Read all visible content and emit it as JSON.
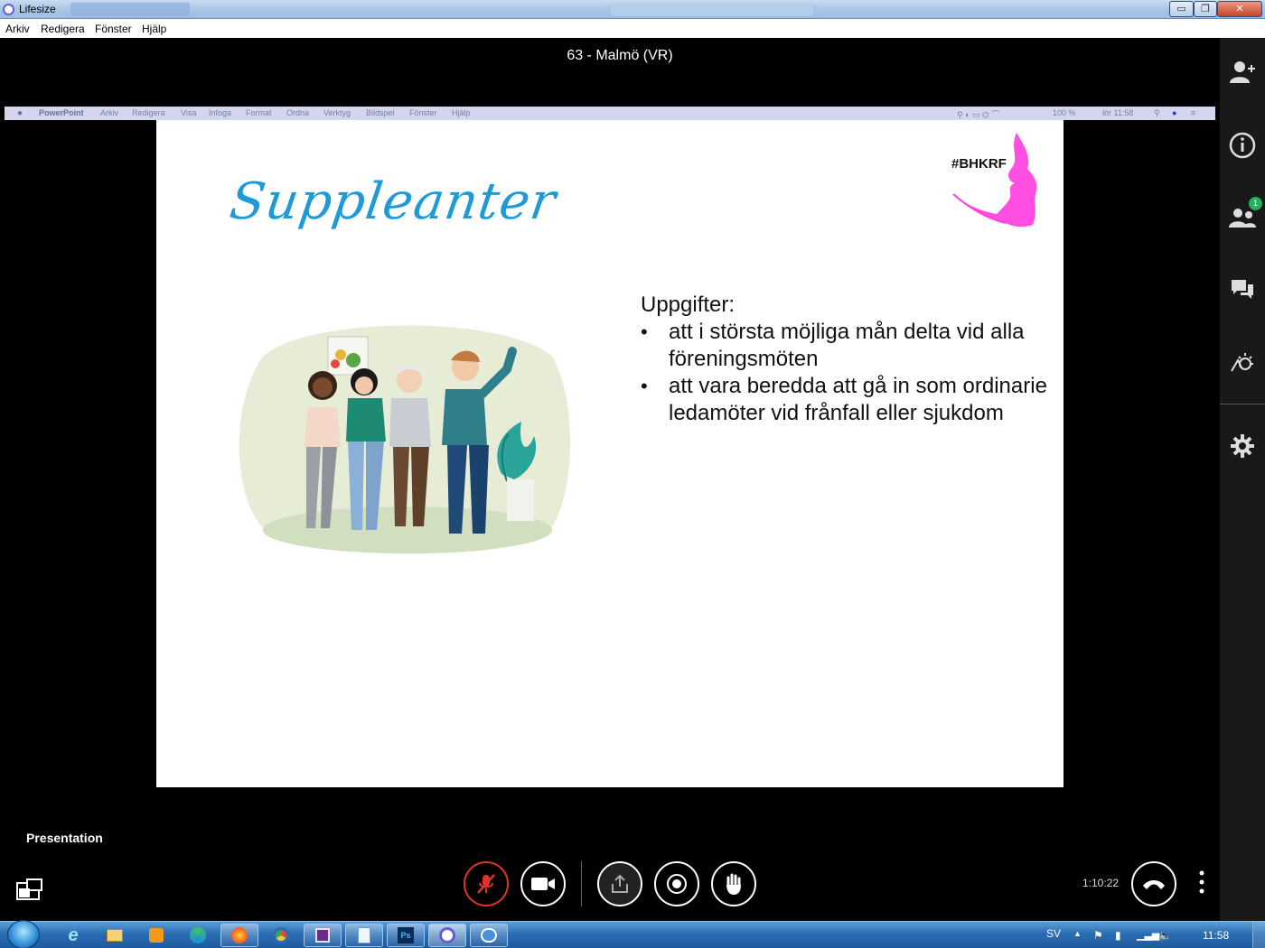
{
  "window": {
    "title": "Lifesize",
    "minimize_glyph": "▭",
    "maximize_glyph": "❐",
    "close_glyph": "✕"
  },
  "menu": {
    "items": [
      "Arkiv",
      "Redigera",
      "Fönster",
      "Hjälp"
    ]
  },
  "meeting": {
    "title": "63 - Malmö (VR)",
    "presentation_label": "Presentation",
    "timer": "1:10:22"
  },
  "shared_screen": {
    "mac_menu": [
      "PowerPoint",
      "Arkiv",
      "Redigera",
      "Visa",
      "Infoga",
      "Format",
      "Ordna",
      "Verktyg",
      "Bildspel",
      "Fönster",
      "Hjälp"
    ],
    "mac_status": [
      "100 %",
      "lör 11:58"
    ]
  },
  "slide": {
    "title": "Suppleanter",
    "brand": "#BHKRF",
    "tasks_heading": "Uppgifter:",
    "tasks": [
      "att i största möjliga mån delta vid alla föreningsmöten",
      "att vara beredda att gå in som ordinarie ledamöter vid frånfall eller sjukdom"
    ]
  },
  "sidebar": {
    "participants_badge": "1"
  },
  "taskbar": {
    "language": "SV",
    "clock": "11:58"
  },
  "colors": {
    "slide_title": "#1e9bd7",
    "brand_magenta": "#ff3fe0",
    "mute_red": "#e0332d",
    "badge_green": "#27ae60"
  }
}
